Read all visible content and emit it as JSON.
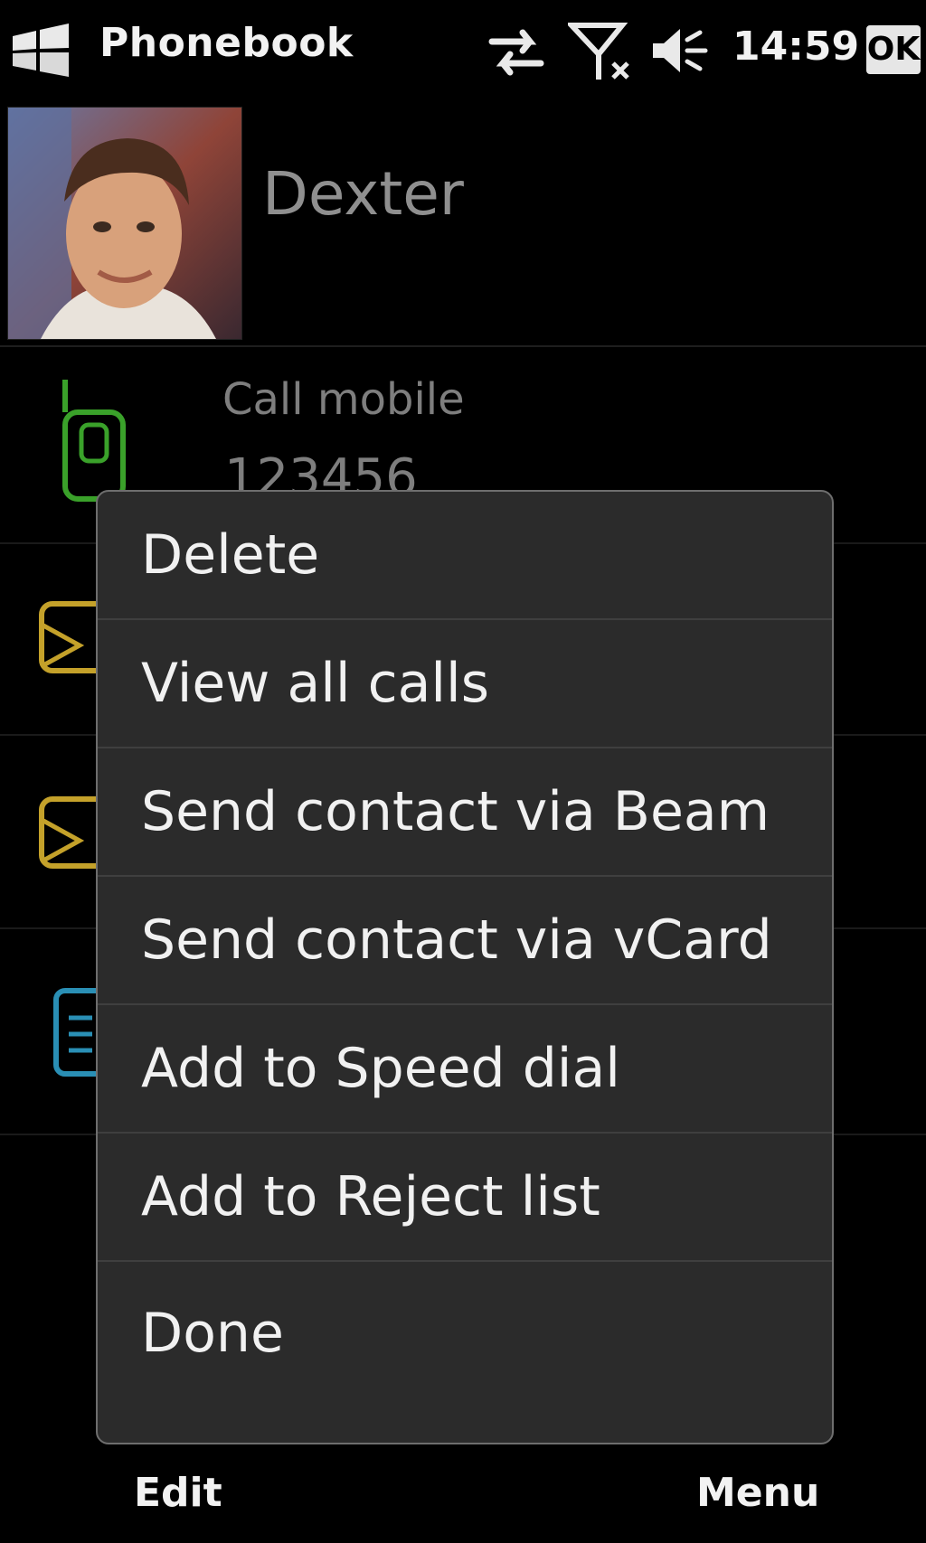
{
  "status_bar": {
    "title": "Phonebook",
    "time": "14:59",
    "ok_label": "OK",
    "icons": [
      "windows-logo-icon",
      "data-sync-icon",
      "no-signal-icon",
      "sound-muted-icon"
    ]
  },
  "contact": {
    "name": "Dexter"
  },
  "rows": [
    {
      "icon": "mobile-phone-icon",
      "label": "Call mobile",
      "value": "123456",
      "color": "#3aa12a"
    },
    {
      "icon": "message-icon",
      "color": "#c4a12a"
    },
    {
      "icon": "email-icon",
      "color": "#c4a12a"
    },
    {
      "icon": "notes-icon",
      "color": "#2a8fb5"
    }
  ],
  "menu": {
    "items": [
      "Delete",
      "View all calls",
      "Send contact via Beam",
      "Send contact via vCard",
      "Add to Speed dial",
      "Add to Reject list",
      "Done"
    ]
  },
  "softkeys": {
    "left": "Edit",
    "right": "Menu"
  }
}
